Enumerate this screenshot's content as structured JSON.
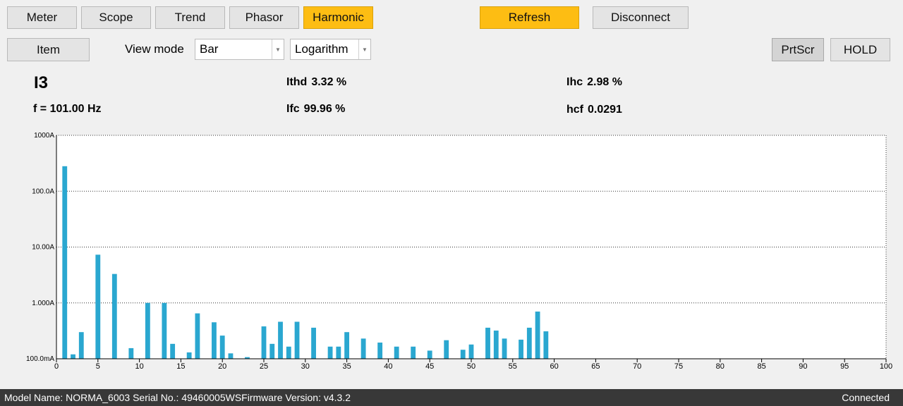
{
  "tabs": [
    {
      "label": "Meter",
      "active": false
    },
    {
      "label": "Scope",
      "active": false
    },
    {
      "label": "Trend",
      "active": false
    },
    {
      "label": "Phasor",
      "active": false
    },
    {
      "label": "Harmonic",
      "active": true
    }
  ],
  "toolbar": {
    "refresh_label": "Refresh",
    "disconnect_label": "Disconnect",
    "item_label": "Item",
    "view_mode_label": "View mode",
    "view_mode_value": "Bar",
    "scale_value": "Logarithm",
    "prtscr_label": "PrtScr",
    "hold_label": "HOLD"
  },
  "info": {
    "channel": "I3",
    "frequency": "f = 101.00 Hz",
    "ithd_label": "Ithd",
    "ithd_value": "3.32 %",
    "ifc_label": "Ifc",
    "ifc_value": "99.96 %",
    "ihc_label": "Ihc",
    "ihc_value": "2.98 %",
    "hcf_label": "hcf",
    "hcf_value": "0.0291"
  },
  "colors": {
    "accent": "#fdbd13",
    "bar": "#2aa7d0",
    "statusbar": "#383838"
  },
  "chart_data": {
    "type": "bar",
    "scale": "log",
    "bar_color": "#2aa7d0",
    "x_ticks": [
      0,
      5,
      10,
      15,
      20,
      25,
      30,
      35,
      40,
      45,
      50,
      55,
      60,
      65,
      70,
      75,
      80,
      85,
      90,
      95,
      100
    ],
    "y_ticks": [
      {
        "value": 1000,
        "label": "1000A"
      },
      {
        "value": 100,
        "label": "100.0A"
      },
      {
        "value": 10,
        "label": "10.00A"
      },
      {
        "value": 1,
        "label": "1.000A"
      },
      {
        "value": 0.1,
        "label": "100.0mA"
      }
    ],
    "ylim": [
      0.1,
      1000
    ],
    "xlim": [
      0,
      100
    ],
    "bars": [
      {
        "h": 1,
        "v": 280
      },
      {
        "h": 2,
        "v": 0.12
      },
      {
        "h": 3,
        "v": 0.3
      },
      {
        "h": 5,
        "v": 7.3
      },
      {
        "h": 7,
        "v": 3.3
      },
      {
        "h": 9,
        "v": 0.155
      },
      {
        "h": 11,
        "v": 1.0
      },
      {
        "h": 13,
        "v": 1.0
      },
      {
        "h": 14,
        "v": 0.185
      },
      {
        "h": 16,
        "v": 0.13
      },
      {
        "h": 17,
        "v": 0.65
      },
      {
        "h": 19,
        "v": 0.45
      },
      {
        "h": 20,
        "v": 0.26
      },
      {
        "h": 21,
        "v": 0.125
      },
      {
        "h": 23,
        "v": 0.107
      },
      {
        "h": 25,
        "v": 0.38
      },
      {
        "h": 26,
        "v": 0.185
      },
      {
        "h": 27,
        "v": 0.46
      },
      {
        "h": 28,
        "v": 0.165
      },
      {
        "h": 29,
        "v": 0.46
      },
      {
        "h": 31,
        "v": 0.36
      },
      {
        "h": 33,
        "v": 0.165
      },
      {
        "h": 34,
        "v": 0.165
      },
      {
        "h": 35,
        "v": 0.3
      },
      {
        "h": 37,
        "v": 0.23
      },
      {
        "h": 39,
        "v": 0.195
      },
      {
        "h": 41,
        "v": 0.165
      },
      {
        "h": 43,
        "v": 0.165
      },
      {
        "h": 45,
        "v": 0.14
      },
      {
        "h": 47,
        "v": 0.215
      },
      {
        "h": 49,
        "v": 0.145
      },
      {
        "h": 50,
        "v": 0.18
      },
      {
        "h": 52,
        "v": 0.36
      },
      {
        "h": 53,
        "v": 0.32
      },
      {
        "h": 54,
        "v": 0.23
      },
      {
        "h": 56,
        "v": 0.22
      },
      {
        "h": 57,
        "v": 0.36
      },
      {
        "h": 58,
        "v": 0.7
      },
      {
        "h": 59,
        "v": 0.31
      }
    ]
  },
  "status": {
    "model_text": "Model Name:  NORMA_6003 Serial No.:  49460005WSFirmware Version:  v4.3.2",
    "connection": "Connected"
  }
}
